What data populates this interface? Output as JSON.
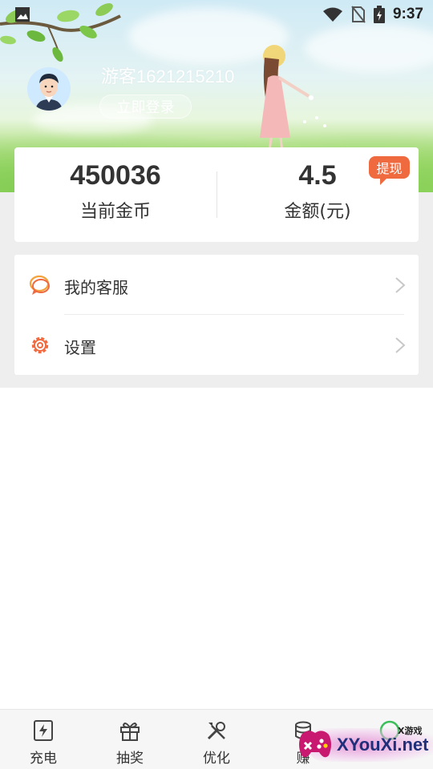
{
  "status_bar": {
    "time": "9:37",
    "icons": [
      "image-notification-icon",
      "wifi-icon",
      "no-sim-icon",
      "battery-charging-icon"
    ]
  },
  "profile": {
    "username": "游客1621215210",
    "login_button": "立即登录",
    "avatar_icon": "user-avatar-icon"
  },
  "stats": {
    "coins_value": "450036",
    "coins_label": "当前金币",
    "amount_value": "4.5",
    "amount_label": "金额(元)",
    "withdraw_label": "提现"
  },
  "menu": {
    "items": [
      {
        "label": "我的客服",
        "icon": "chat-bubble-icon"
      },
      {
        "label": "设置",
        "icon": "gear-icon"
      }
    ]
  },
  "bottom_nav": {
    "items": [
      {
        "label": "充电",
        "icon": "charge-icon"
      },
      {
        "label": "抽奖",
        "icon": "gift-icon"
      },
      {
        "label": "优化",
        "icon": "tools-icon"
      },
      {
        "label": "赚",
        "icon": "coins-icon"
      },
      {
        "label": "",
        "icon": "profile-ring-icon"
      }
    ]
  },
  "watermark": {
    "text": "XYouXi.net",
    "small": "X游戏"
  },
  "colors": {
    "accent": "#f06a3f",
    "text": "#333333",
    "background_grey": "#eeeeee"
  }
}
